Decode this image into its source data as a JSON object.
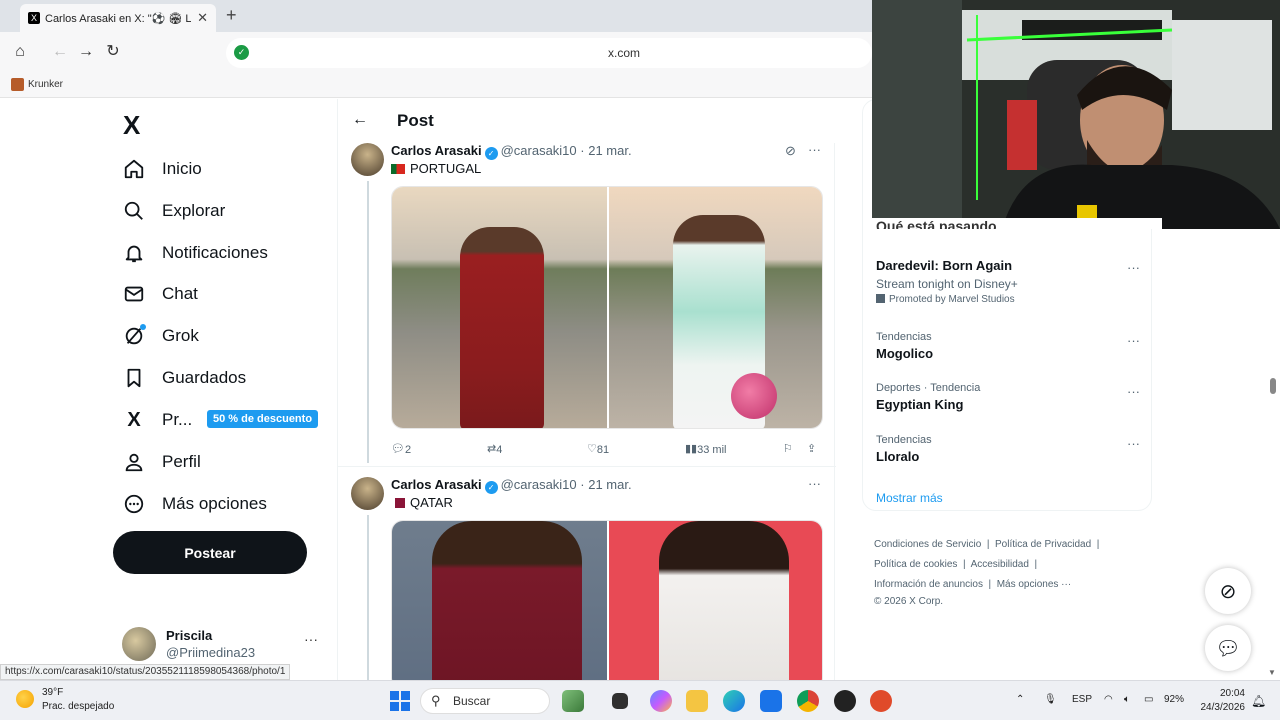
{
  "browser": {
    "tab_title": "Carlos Arasaki en X: \"⚽ 🏟 La",
    "tab_favicon": "X",
    "url": "x.com",
    "bookmark": "Krunker",
    "status_url": "https://x.com/carasaki10/status/2035521118598054368/photo/1"
  },
  "nav": {
    "logo": "X",
    "items": [
      {
        "label": "Inicio",
        "icon": "home-icon"
      },
      {
        "label": "Explorar",
        "icon": "search-icon"
      },
      {
        "label": "Notificaciones",
        "icon": "bell-icon"
      },
      {
        "label": "Chat",
        "icon": "mail-icon"
      },
      {
        "label": "Grok",
        "icon": "grok-icon"
      },
      {
        "label": "Guardados",
        "icon": "bookmark-icon"
      },
      {
        "label": "Pr...",
        "icon": "x-premium-icon"
      },
      {
        "label": "Perfil",
        "icon": "person-icon"
      },
      {
        "label": "Más opciones",
        "icon": "more-circle-icon"
      }
    ],
    "premium_badge": "50 % de descuento",
    "post_button": "Postear",
    "account": {
      "name": "Priscila",
      "handle": "@Priimedina23"
    }
  },
  "main": {
    "header": "Post",
    "tweets": [
      {
        "name": "Carlos Arasaki",
        "handle": "@carasaki10",
        "date": "21 mar.",
        "text": "PORTUGAL",
        "replies": "2",
        "reposts": "4",
        "likes": "81",
        "views": "33 mil"
      },
      {
        "name": "Carlos Arasaki",
        "handle": "@carasaki10",
        "date": "21 mar.",
        "text": "QATAR"
      }
    ]
  },
  "sidebar": {
    "partial_heading": "Qué está pasando",
    "trends": [
      {
        "title": "Daredevil: Born Again",
        "line2": "Stream tonight on Disney+",
        "promo": "Promoted by Marvel Studios"
      },
      {
        "category": "Tendencias",
        "title": "Mogolico"
      },
      {
        "category": "Deportes · Tendencia",
        "title": "Egyptian King"
      },
      {
        "category": "Tendencias",
        "title": "Lloralo"
      }
    ],
    "show_more": "Mostrar más",
    "footer": {
      "tos": "Condiciones de Servicio",
      "privacy": "Política de Privacidad",
      "cookies": "Política de cookies",
      "accessibility": "Accesibilidad",
      "ads": "Información de anuncios",
      "more": "Más opciones ···",
      "copyright": "© 2026 X Corp."
    }
  },
  "taskbar": {
    "weather_temp": "39°F",
    "weather_cond": "Prac. despejado",
    "search_placeholder": "Buscar",
    "lang": "ESP",
    "battery": "92%",
    "time": "20:04",
    "date": "24/3/2026"
  }
}
